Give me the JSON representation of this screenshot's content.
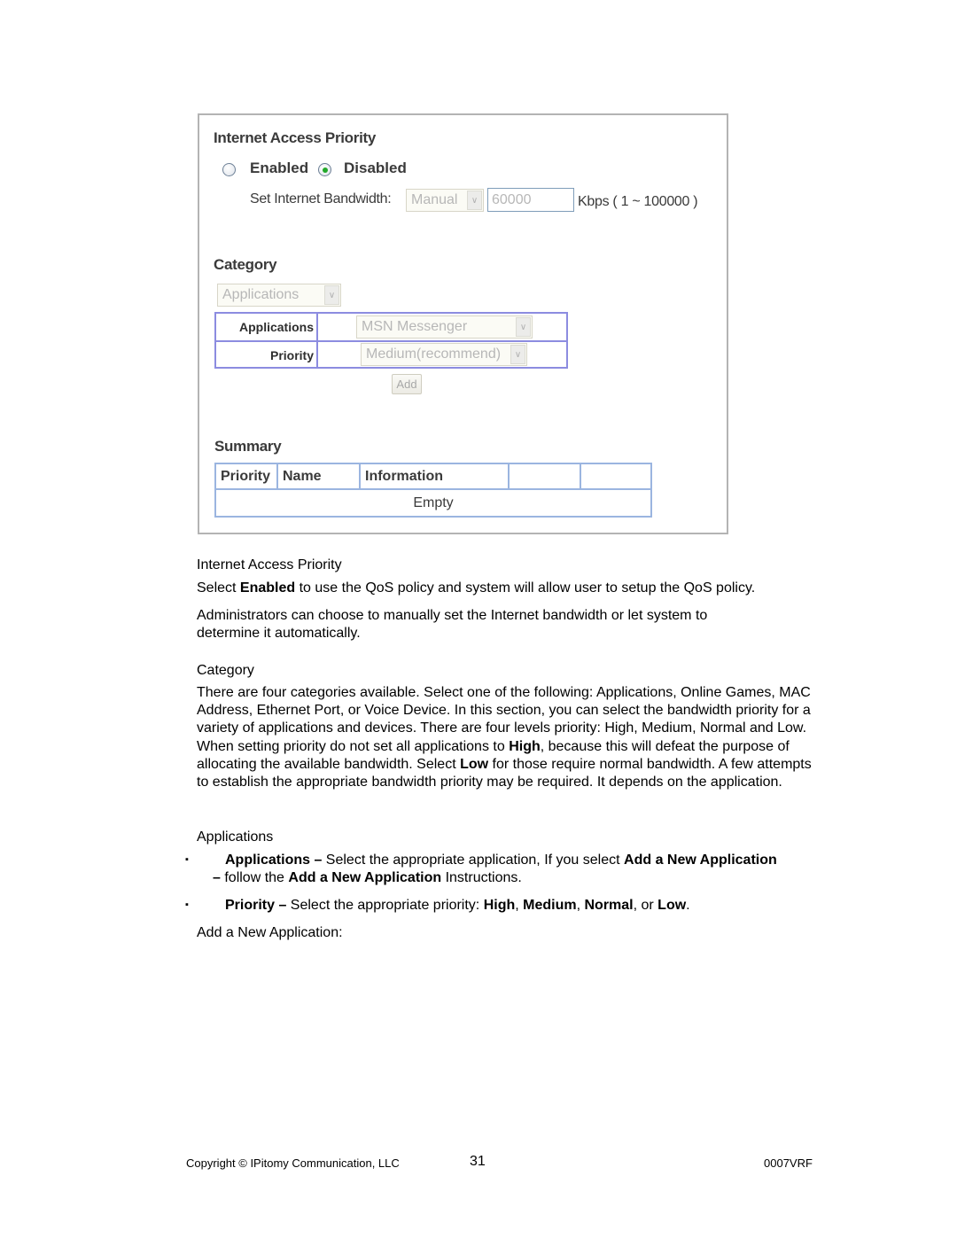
{
  "panel": {
    "iap_title": "Internet Access Priority",
    "radio_enabled": {
      "label": "Enabled",
      "selected": false
    },
    "radio_disabled": {
      "label": "Disabled",
      "selected": true
    },
    "bandwidth_label": "Set Internet Bandwidth:",
    "bandwidth_mode": "Manual",
    "bandwidth_value": "60000",
    "bandwidth_unit": "Kbps ( 1 ~ 100000 )",
    "category_title": "Category",
    "category_select": "Applications",
    "category_table": {
      "applications_label": "Applications",
      "applications_value": "MSN Messenger",
      "priority_label": "Priority",
      "priority_value": "Medium(recommend)"
    },
    "add_button": "Add",
    "summary_title": "Summary",
    "summary_table": {
      "columns": [
        "Priority",
        "Name",
        "Information",
        "",
        ""
      ],
      "empty_text": "Empty"
    },
    "colors": {
      "radio_dot": "#22a829",
      "category_border": "#8c8ce0",
      "summary_border": "#9bb5e0"
    }
  },
  "doc": {
    "h_iap": "Internet Access Priority",
    "p_iap1_pre": "Select ",
    "p_iap1_bold": "Enabled",
    "p_iap1_post": " to use the QoS policy and system will allow user to setup the QoS policy.",
    "p_iap2": "Administrators can choose to manually set the Internet bandwidth or let system to determine it automatically.",
    "h_category": "Category",
    "p_cat_a": "There are four categories available. Select one of the following: Applications, Online Games, MAC Address, Ethernet Port, or Voice Device. In this section, you can select the bandwidth priority for a variety of applications and devices. There are four levels priority: High, Medium, Normal and Low. When setting priority do not set all applications to ",
    "p_cat_high": "High",
    "p_cat_b": ", because this will defeat the purpose of allocating the available bandwidth. Select ",
    "p_cat_low": "Low",
    "p_cat_c": " for those require normal bandwidth. A few attempts to establish the appropriate bandwidth priority may be required. It depends on the application.",
    "h_apps": "Applications",
    "bullet1": {
      "b1": "Applications –",
      "t1": " Select the appropriate application, If you select ",
      "b2": "Add a New Application –",
      "t2": " follow the ",
      "b3": "Add a New Application",
      "t3": " Instructions."
    },
    "bullet2": {
      "b1": "Priority –",
      "t1": " Select the appropriate priority: ",
      "b2": "High",
      "t2": ", ",
      "b3": "Medium",
      "t3": ", ",
      "b4": "Normal",
      "t4": ", or ",
      "b5": "Low",
      "t5": "."
    },
    "bullet_glyph": "▪",
    "h_add_new": "Add a New Application:"
  },
  "footer": {
    "copyright": "Copyright © IPitomy Communication, LLC",
    "page_number": "31",
    "doc_code": "0007VRF"
  }
}
